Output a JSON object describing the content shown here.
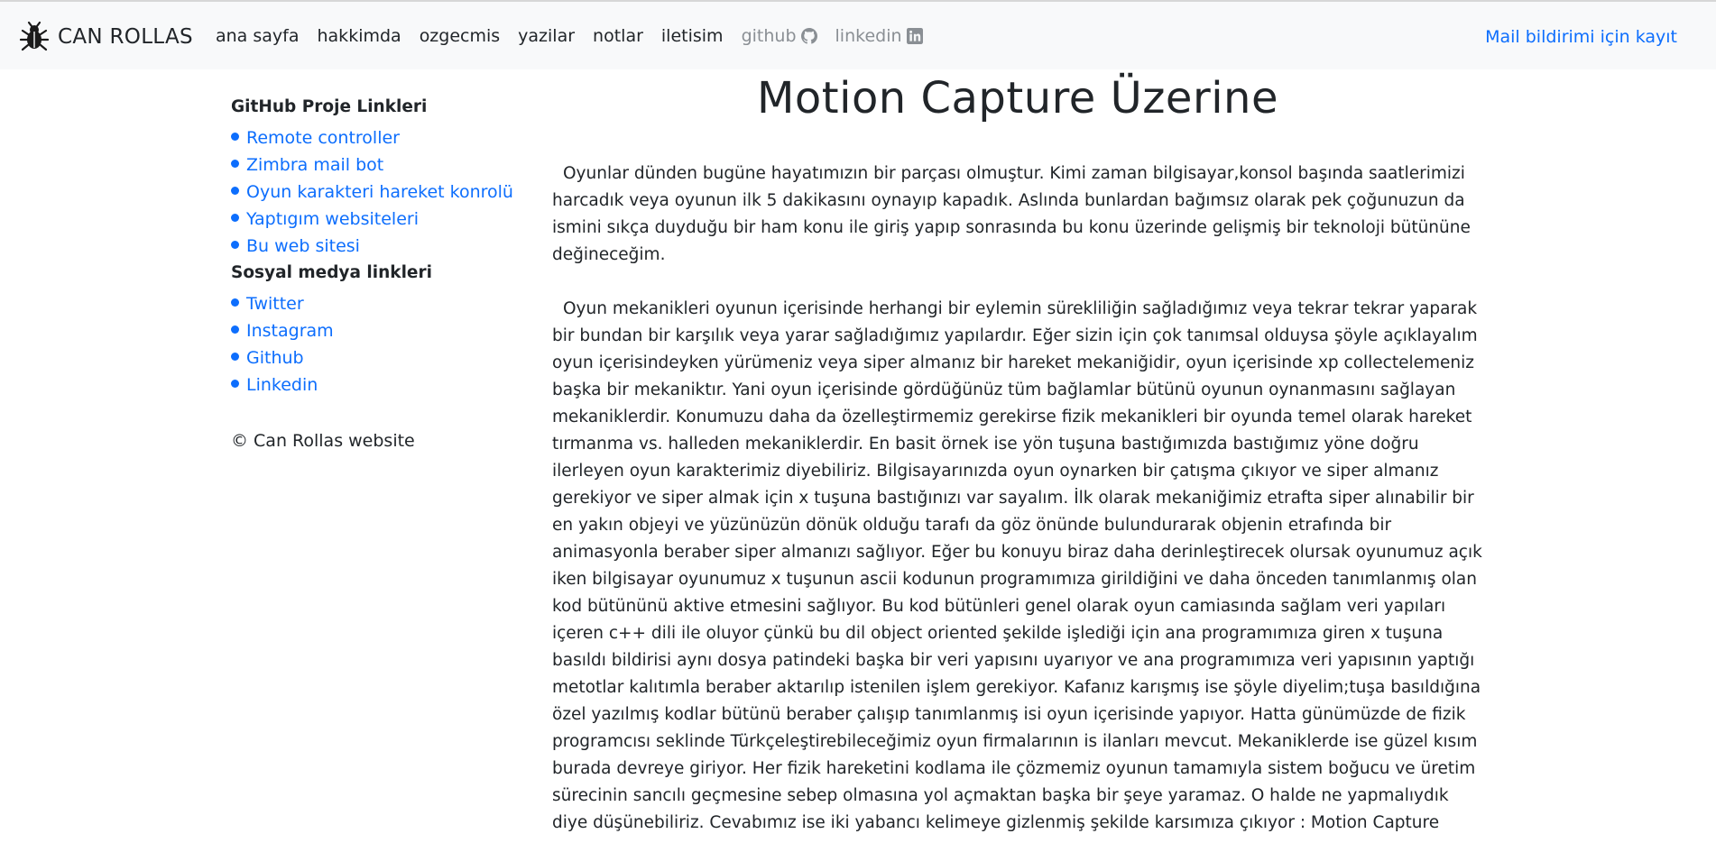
{
  "navbar": {
    "brand": "CAN ROLLAS",
    "brand_icon": "bug-icon",
    "links": [
      {
        "label": "ana sayfa"
      },
      {
        "label": "hakkimda"
      },
      {
        "label": "ozgecmis"
      },
      {
        "label": "yazilar"
      },
      {
        "label": "notlar"
      },
      {
        "label": "iletisim"
      },
      {
        "label": "github",
        "icon": "github-icon"
      },
      {
        "label": "linkedin",
        "icon": "linkedin-icon"
      }
    ],
    "right_link": "Mail bildirimi için kayıt"
  },
  "sidebar": {
    "projects_heading": "GitHub Proje Linkleri",
    "projects": [
      "Remote controller",
      "Zimbra mail bot",
      "Oyun karakteri hareket konrolü",
      "Yaptıgım websiteleri",
      "Bu web sitesi"
    ],
    "social_heading": "Sosyal medya linkleri",
    "social": [
      "Twitter",
      "Instagram",
      "Github",
      "Linkedin"
    ],
    "copyright": "© Can Rollas website"
  },
  "article": {
    "title": "Motion Capture Üzerine",
    "paragraphs": [
      "Oyunlar dünden bugüne hayatımızın bir parçası olmuştur. Kimi zaman bilgisayar,konsol başında saatlerimizi harcadık veya oyunun ilk 5 dakikasını oynayıp kapadık. Aslında bunlardan bağımsız olarak pek çoğunuzun da ismini sıkça duyduğu bir ham konu ile giriş yapıp sonrasında bu konu üzerinde gelişmiş bir teknoloji bütününe değineceğim.",
      "Oyun mekanikleri oyunun içerisinde herhangi bir eylemin sürekliliğin sağladığımız veya tekrar tekrar yaparak bir bundan bir karşılık veya yarar sağladığımız yapılardır. Eğer sizin için çok tanımsal olduysa şöyle açıklayalım oyun içerisindeyken yürümeniz veya siper almanız bir hareket mekaniğidir, oyun içerisinde xp collectelemeniz başka bir mekaniktır. Yani oyun içerisinde gördüğünüz tüm bağlamlar bütünü oyunun oynanmasını sağlayan mekaniklerdir. Konumuzu daha da özelleştirmemiz gerekirse fizik mekanikleri bir oyunda temel olarak hareket tırmanma vs. halleden mekaniklerdir. En basit örnek ise yön tuşuna bastığımızda bastığımız yöne doğru ilerleyen oyun karakterimiz diyebiliriz. Bilgisayarınızda oyun oynarken bir çatışma çıkıyor ve siper almanız gerekiyor ve siper almak için x tuşuna bastığınızı var sayalım. İlk olarak mekaniğimiz etrafta siper alınabilir bir en yakın objeyi ve yüzünüzün dönük olduğu tarafı da göz önünde bulundurarak objenin etrafında bir animasyonla beraber siper almanızı sağlıyor. Eğer bu konuyu biraz daha derinleştirecek olursak oyunumuz açık iken bilgisayar oyunumuz x tuşunun ascii kodunun programımıza girildiğini ve daha önceden tanımlanmış olan kod bütününü aktive etmesini sağlıyor. Bu kod bütünleri genel olarak oyun camiasında sağlam veri yapıları içeren c++ dili ile oluyor çünkü bu dil object oriented şekilde işlediği için ana programımıza giren x tuşuna basıldı bildirisi aynı dosya patindeki başka bir veri yapısını uyarıyor ve ana programımıza veri yapısının yaptığı metotlar kalıtımla beraber aktarılıp istenilen işlem gerekiyor. Kafanız karışmış ise şöyle diyelim;tuşa basıldığına özel yazılmış kodlar bütünü beraber çalışıp tanımlanmış isi oyun içerisinde yapıyor. Hatta günümüzde de fizik programcısı seklinde Türkçeleştirebileceğimiz oyun firmalarının is ilanları mevcut. Mekaniklerde ise güzel kısım burada devreye giriyor. Her fizik hareketini kodlama ile çözmemiz oyunun tamamıyla sistem boğucu ve üretim sürecinin sancılı geçmesine sebep olmasına yol açmaktan başka bir şeye yaramaz. O halde ne yapmalıydık diye düşünebiliriz. Cevabımız ise iki yabancı kelimeye gizlenmiş şekilde karsımıza çıkıyor : Motion Capture"
    ]
  },
  "colors": {
    "navbar_bg": "#f8f9fa",
    "link": "#0d6efd",
    "text": "#212529",
    "muted": "#8a8f94"
  }
}
